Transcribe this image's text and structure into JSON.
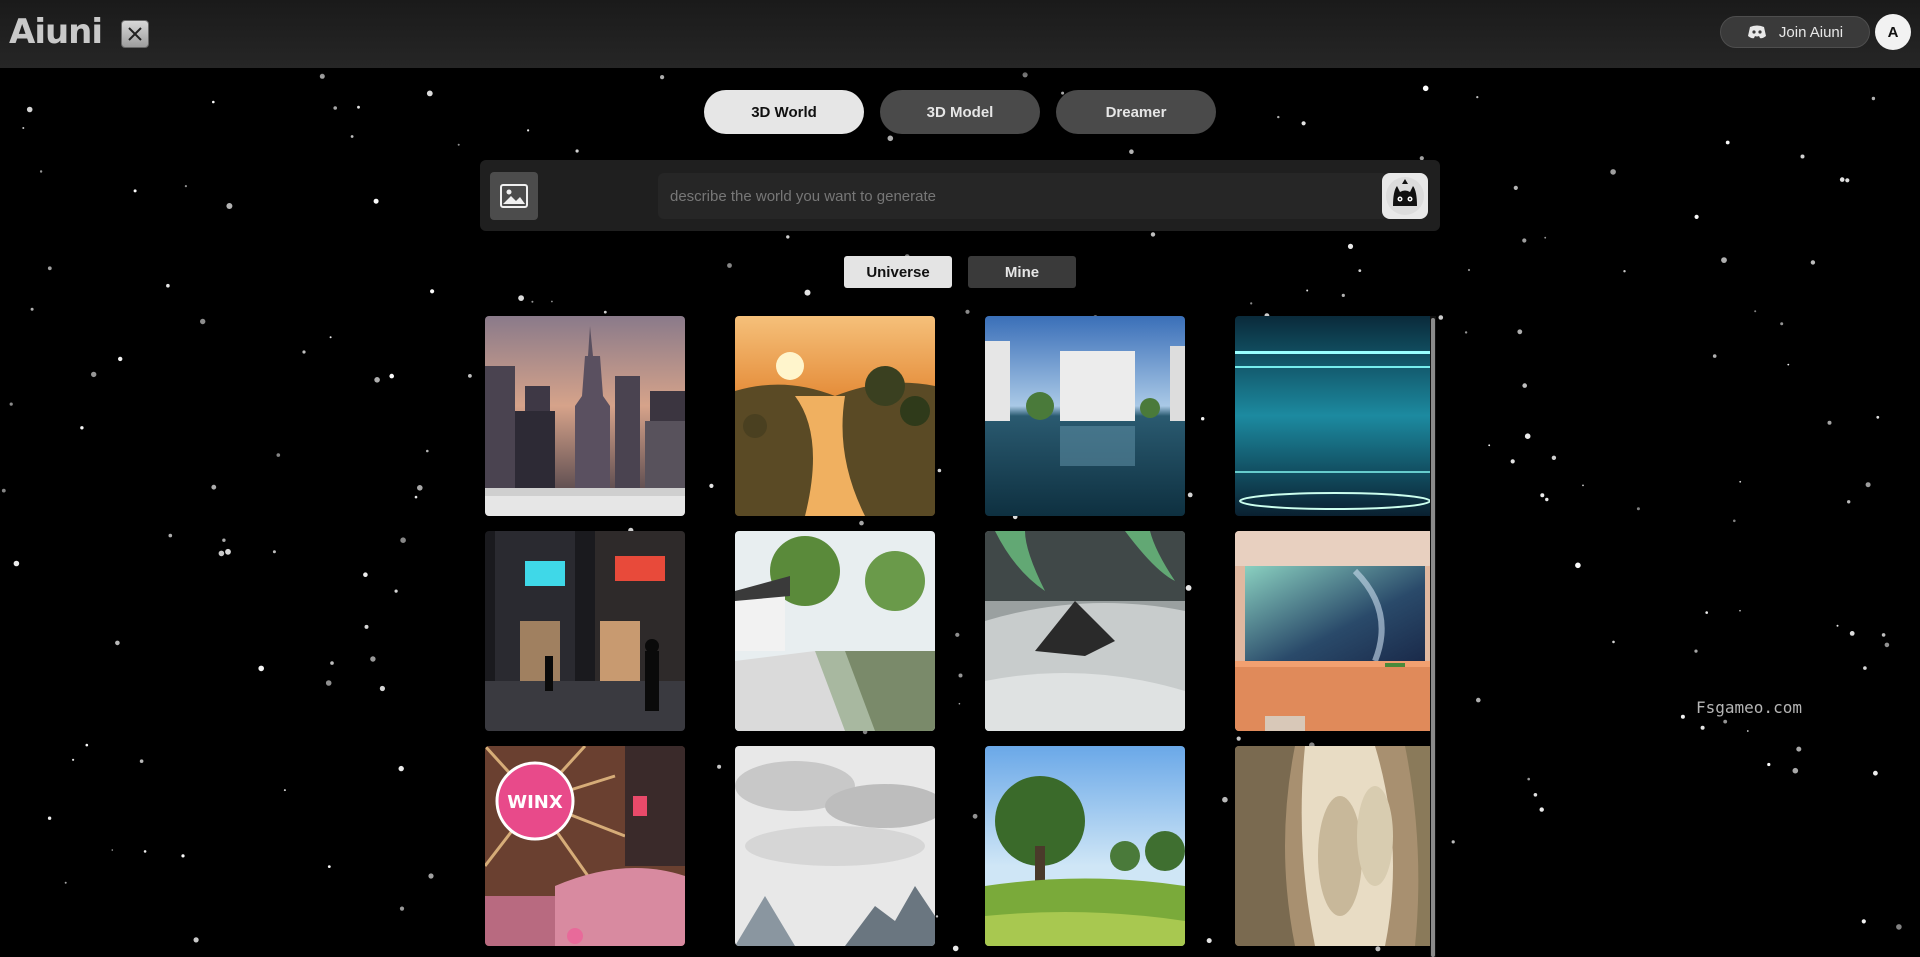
{
  "header": {
    "logo": "Aiuni",
    "x_icon": "x-logo-icon",
    "join_label": "Join Aiuni",
    "join_icon": "discord-icon",
    "avatar_initial": "A"
  },
  "mode_tabs": [
    {
      "label": "3D World",
      "active": true
    },
    {
      "label": "3D Model",
      "active": false
    },
    {
      "label": "Dreamer",
      "active": false
    }
  ],
  "prompt": {
    "placeholder": "describe the world you want to generate",
    "upload_icon": "image-icon",
    "generate_icon": "cat-mascot-icon"
  },
  "sub_tabs": [
    {
      "label": "Universe",
      "active": true
    },
    {
      "label": "Mine",
      "active": false
    }
  ],
  "gallery": {
    "items": [
      "city-skyline-thumbnail",
      "sunset-river-thumbnail",
      "flooded-buildings-thumbnail",
      "teal-water-room-thumbnail",
      "neon-street-thumbnail",
      "chinese-canal-thumbnail",
      "aurora-mountains-thumbnail",
      "space-window-room-thumbnail",
      "winx-club-bar-thumbnail",
      "cloud-peaks-thumbnail",
      "green-meadow-tree-thumbnail",
      "carved-stone-thumbnail"
    ],
    "winx_sign_text": "WINX"
  },
  "watermark": "Fsgameo.com",
  "colors": {
    "background": "#000000",
    "active_tab": "#e6e6e6",
    "inactive_tab": "#4a4a4a",
    "panel": "#1f1f1f"
  }
}
